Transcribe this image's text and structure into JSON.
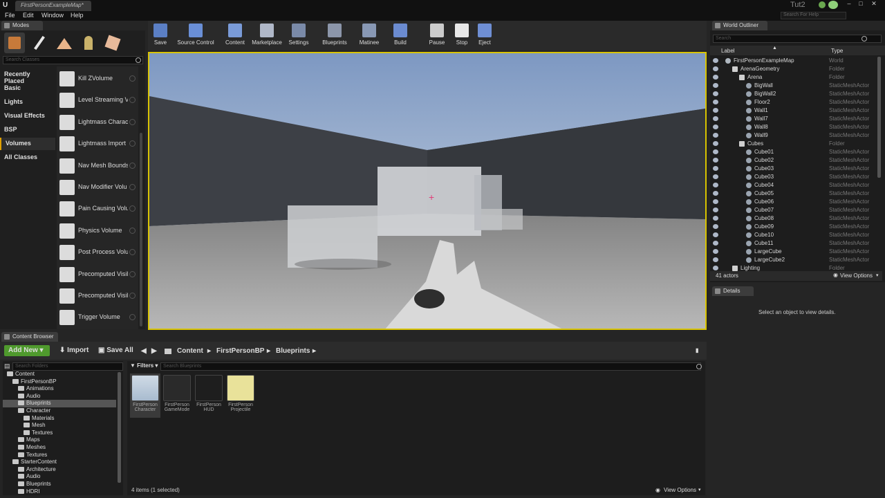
{
  "title_bar": {
    "doc_tab": "FirstPersonExampleMap*",
    "project": "Tut2",
    "search_help_placeholder": "Search For Help"
  },
  "menu": [
    "File",
    "Edit",
    "Window",
    "Help"
  ],
  "modes": {
    "tab": "Modes",
    "search_placeholder": "Search Classes",
    "categories": [
      "Recently Placed",
      "Basic",
      "Lights",
      "Visual Effects",
      "BSP",
      "Volumes",
      "All Classes"
    ],
    "active_category": "Volumes",
    "items": [
      "Kill ZVolume",
      "Level Streaming V",
      "Lightmass Charac",
      "Lightmass Import",
      "Nav Mesh Bounds",
      "Nav Modifier Volu",
      "Pain Causing Volu",
      "Physics Volume",
      "Post Process Volu",
      "Precomputed Visil",
      "Precomputed Visil",
      "Trigger Volume"
    ]
  },
  "toolbar": [
    "Save",
    "Source Control",
    "Content",
    "Marketplace",
    "Settings",
    "Blueprints",
    "Matinee",
    "Build",
    "Pause",
    "Stop",
    "Eject"
  ],
  "outliner": {
    "tab": "World Outliner",
    "search_placeholder": "Search",
    "col_label": "Label",
    "col_type": "Type",
    "rows": [
      {
        "name": "FirstPersonExampleMap",
        "type": "World",
        "indent": 0,
        "kind": "world"
      },
      {
        "name": "ArenaGeometry",
        "type": "Folder",
        "indent": 1,
        "kind": "folder"
      },
      {
        "name": "Arena",
        "type": "Folder",
        "indent": 2,
        "kind": "folder"
      },
      {
        "name": "BigWall",
        "type": "StaticMeshActor",
        "indent": 3,
        "kind": "mesh"
      },
      {
        "name": "BigWall2",
        "type": "StaticMeshActor",
        "indent": 3,
        "kind": "mesh"
      },
      {
        "name": "Floor2",
        "type": "StaticMeshActor",
        "indent": 3,
        "kind": "mesh"
      },
      {
        "name": "Wall1",
        "type": "StaticMeshActor",
        "indent": 3,
        "kind": "mesh"
      },
      {
        "name": "Wall7",
        "type": "StaticMeshActor",
        "indent": 3,
        "kind": "mesh"
      },
      {
        "name": "Wall8",
        "type": "StaticMeshActor",
        "indent": 3,
        "kind": "mesh"
      },
      {
        "name": "Wall9",
        "type": "StaticMeshActor",
        "indent": 3,
        "kind": "mesh"
      },
      {
        "name": "Cubes",
        "type": "Folder",
        "indent": 2,
        "kind": "folder"
      },
      {
        "name": "Cube01",
        "type": "StaticMeshActor",
        "indent": 3,
        "kind": "mesh"
      },
      {
        "name": "Cube02",
        "type": "StaticMeshActor",
        "indent": 3,
        "kind": "mesh"
      },
      {
        "name": "Cube03",
        "type": "StaticMeshActor",
        "indent": 3,
        "kind": "mesh"
      },
      {
        "name": "Cube03",
        "type": "StaticMeshActor",
        "indent": 3,
        "kind": "mesh"
      },
      {
        "name": "Cube04",
        "type": "StaticMeshActor",
        "indent": 3,
        "kind": "mesh"
      },
      {
        "name": "Cube05",
        "type": "StaticMeshActor",
        "indent": 3,
        "kind": "mesh"
      },
      {
        "name": "Cube06",
        "type": "StaticMeshActor",
        "indent": 3,
        "kind": "mesh"
      },
      {
        "name": "Cube07",
        "type": "StaticMeshActor",
        "indent": 3,
        "kind": "mesh"
      },
      {
        "name": "Cube08",
        "type": "StaticMeshActor",
        "indent": 3,
        "kind": "mesh"
      },
      {
        "name": "Cube09",
        "type": "StaticMeshActor",
        "indent": 3,
        "kind": "mesh"
      },
      {
        "name": "Cube10",
        "type": "StaticMeshActor",
        "indent": 3,
        "kind": "mesh"
      },
      {
        "name": "Cube11",
        "type": "StaticMeshActor",
        "indent": 3,
        "kind": "mesh"
      },
      {
        "name": "LargeCube",
        "type": "StaticMeshActor",
        "indent": 3,
        "kind": "mesh"
      },
      {
        "name": "LargeCube2",
        "type": "StaticMeshActor",
        "indent": 3,
        "kind": "mesh"
      },
      {
        "name": "Lighting",
        "type": "Folder",
        "indent": 1,
        "kind": "folder"
      }
    ],
    "actor_count": "41 actors",
    "view_options": "View Options"
  },
  "details": {
    "tab": "Details",
    "empty_text": "Select an object to view details."
  },
  "content_browser": {
    "tab": "Content Browser",
    "add_new": "Add New",
    "import": "Import",
    "save_all": "Save All",
    "breadcrumb": [
      "Content",
      "FirstPersonBP",
      "Blueprints"
    ],
    "folder_search_placeholder": "Search Folders",
    "filters": "Filters",
    "asset_search_placeholder": "Search Blueprints",
    "folders": [
      {
        "name": "Content",
        "indent": 0
      },
      {
        "name": "FirstPersonBP",
        "indent": 1
      },
      {
        "name": "Animations",
        "indent": 2
      },
      {
        "name": "Audio",
        "indent": 2
      },
      {
        "name": "Blueprints",
        "indent": 2,
        "selected": true
      },
      {
        "name": "Character",
        "indent": 2
      },
      {
        "name": "Materials",
        "indent": 3
      },
      {
        "name": "Mesh",
        "indent": 3
      },
      {
        "name": "Textures",
        "indent": 3
      },
      {
        "name": "Maps",
        "indent": 2
      },
      {
        "name": "Meshes",
        "indent": 2
      },
      {
        "name": "Textures",
        "indent": 2
      },
      {
        "name": "StarterContent",
        "indent": 1
      },
      {
        "name": "Architecture",
        "indent": 2
      },
      {
        "name": "Audio",
        "indent": 2
      },
      {
        "name": "Blueprints",
        "indent": 2
      },
      {
        "name": "HDRI",
        "indent": 2
      }
    ],
    "assets": [
      {
        "line1": "FirstPerson",
        "line2": "Character",
        "selected": true
      },
      {
        "line1": "FirstPerson",
        "line2": "GameMode"
      },
      {
        "line1": "FirstPerson",
        "line2": "HUD"
      },
      {
        "line1": "FirstPerson",
        "line2": "Projectile"
      }
    ],
    "status": "4 items (1 selected)",
    "view_options": "View Options"
  }
}
